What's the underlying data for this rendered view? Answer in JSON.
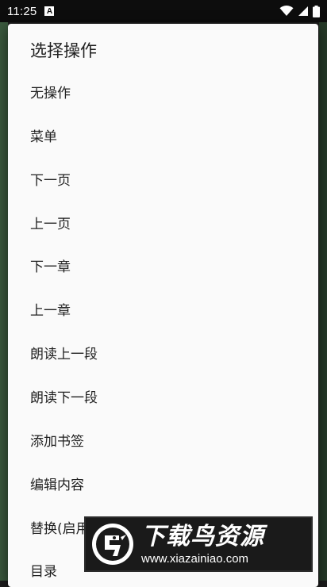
{
  "status_bar": {
    "time": "11:25",
    "notification_glyph": "A",
    "icons": [
      "wifi-icon",
      "signal-icon",
      "battery-icon"
    ]
  },
  "dialog": {
    "title": "选择操作",
    "options": [
      {
        "label": "无操作"
      },
      {
        "label": "菜单"
      },
      {
        "label": "下一页"
      },
      {
        "label": "上一页"
      },
      {
        "label": "下一章"
      },
      {
        "label": "上一章"
      },
      {
        "label": "朗读上一段"
      },
      {
        "label": "朗读下一段"
      },
      {
        "label": "添加书签"
      },
      {
        "label": "编辑内容"
      },
      {
        "label": "替换(启用"
      },
      {
        "label": "目录"
      }
    ]
  },
  "watermark": {
    "name": "下载鸟资源",
    "url": "www.xiazainiao.com"
  },
  "colors": {
    "dialog_bg": "#fafafa",
    "text": "#212121",
    "status_bar_bg": "#0d0d0d"
  }
}
